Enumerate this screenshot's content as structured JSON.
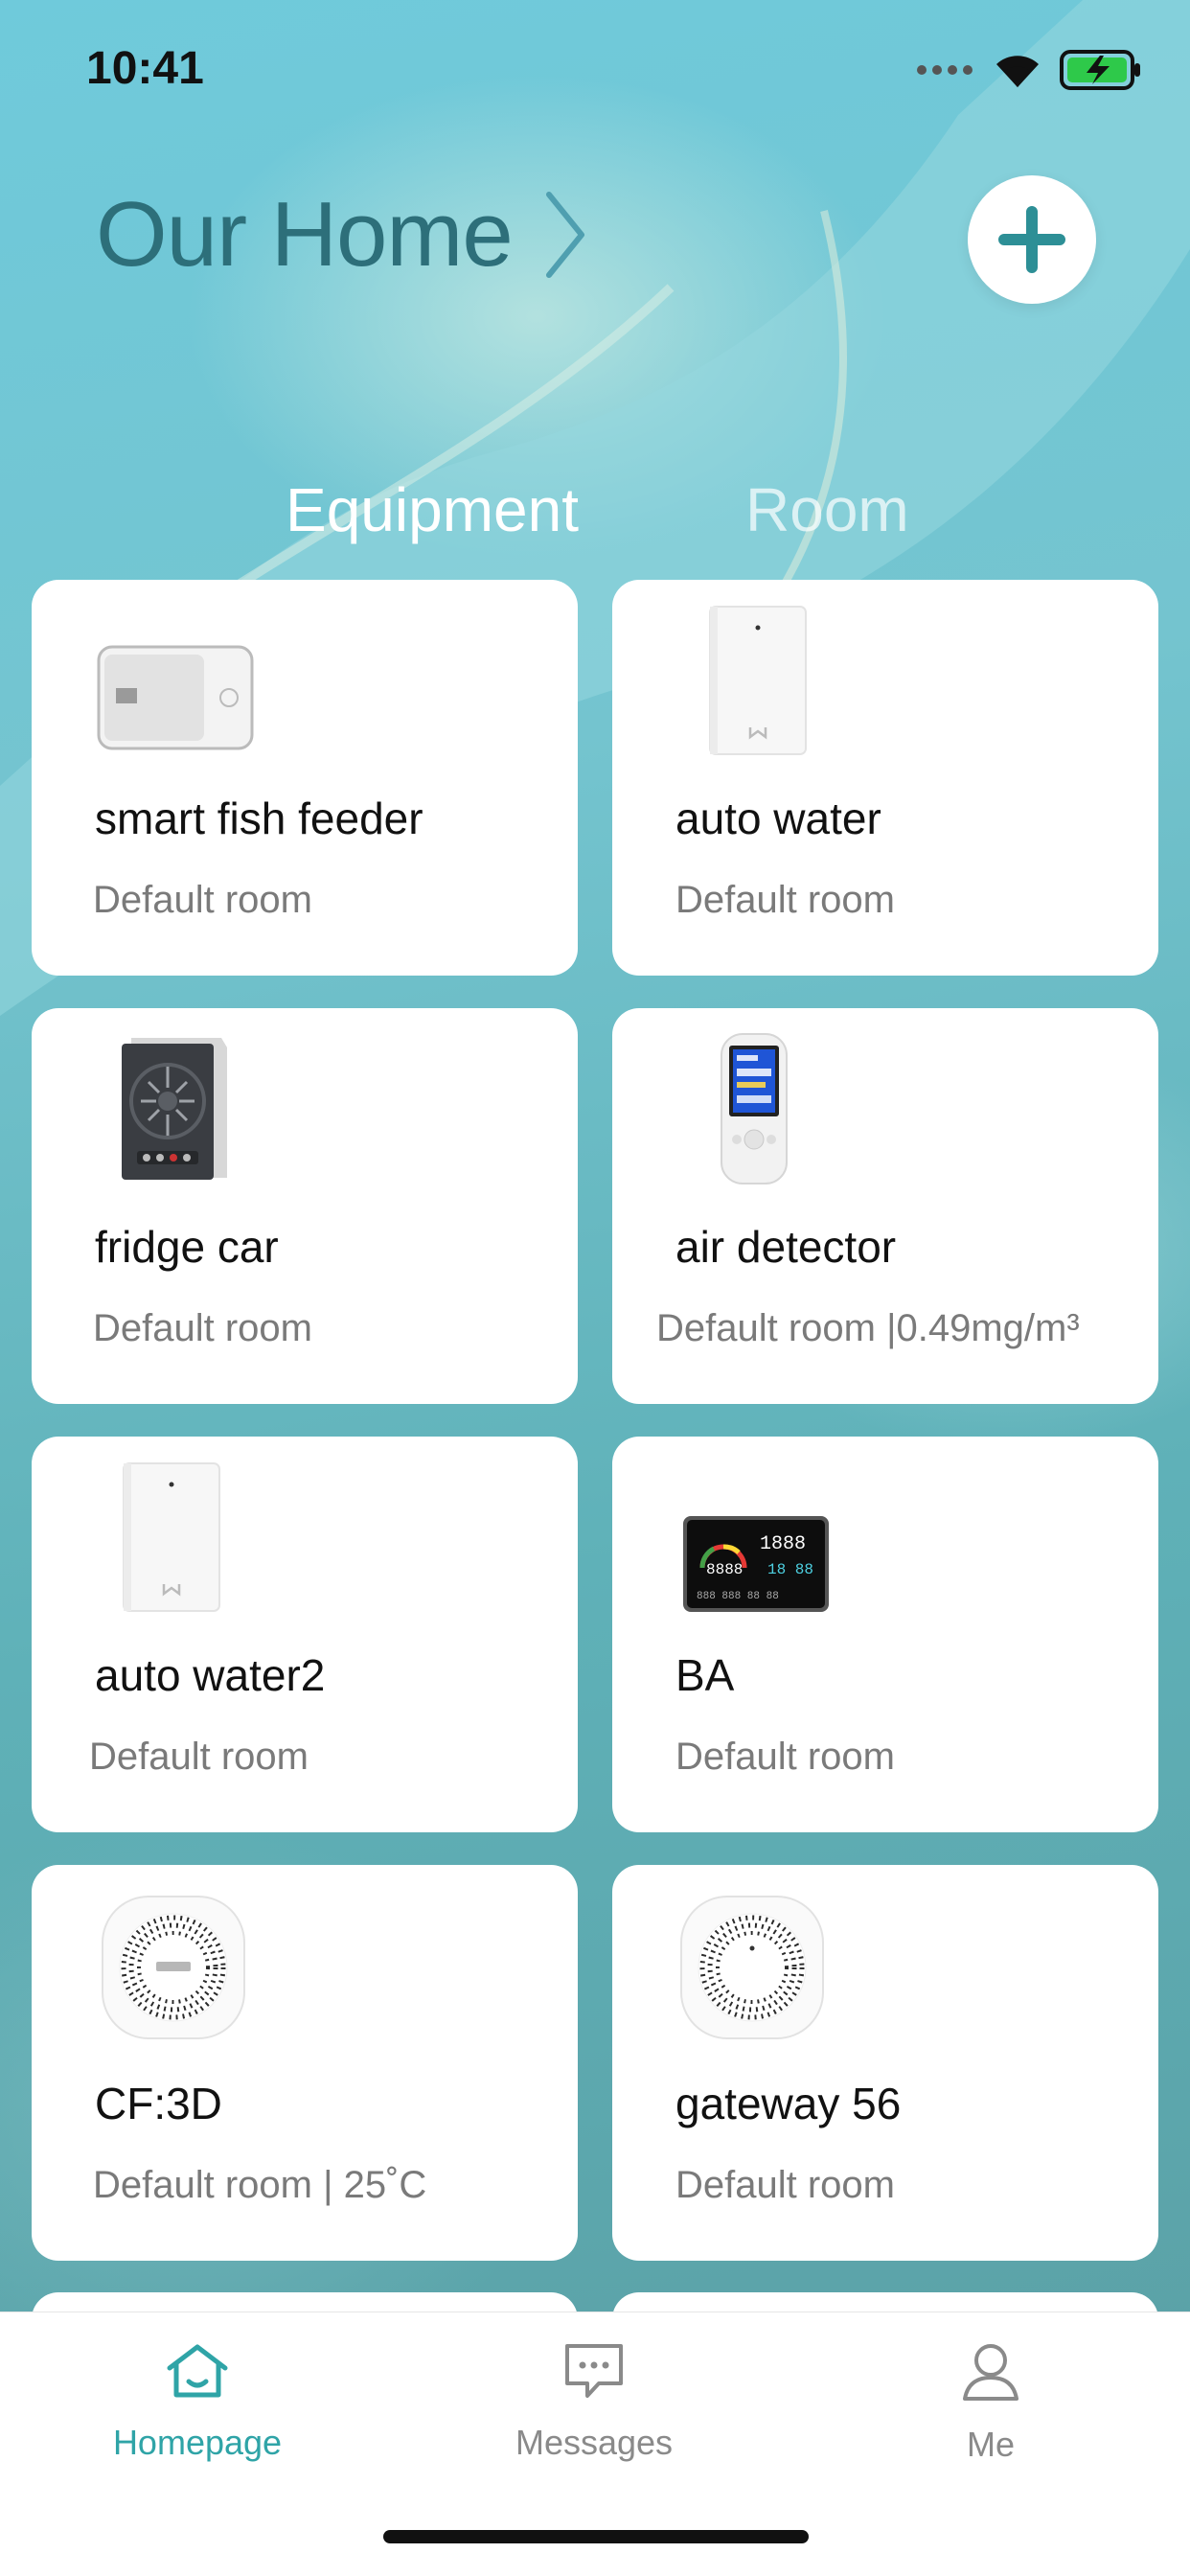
{
  "status_bar": {
    "time": "10:41",
    "icons": [
      "signal-dots-icon",
      "wifi-icon",
      "battery-charging-icon"
    ]
  },
  "header": {
    "title": "Our Home",
    "title_icon": "chevron-right-icon",
    "add_icon": "plus-icon"
  },
  "tabs": {
    "equipment": "Equipment",
    "room": "Room",
    "active": "Equipment"
  },
  "devices": [
    {
      "name": "smart fish feeder",
      "room": "Default room",
      "icon": "fish-feeder-device-icon"
    },
    {
      "name": "auto water",
      "room": "Default room",
      "icon": "water-dispenser-device-icon"
    },
    {
      "name": "fridge car",
      "room": "Default room",
      "icon": "car-fridge-device-icon"
    },
    {
      "name": "air detector",
      "room": "Default room |0.49mg/m³",
      "icon": "air-detector-device-icon"
    },
    {
      "name": "auto water2",
      "room": "Default room",
      "icon": "water-dispenser-device-icon"
    },
    {
      "name": "BA",
      "room": "Default room",
      "icon": "air-monitor-display-device-icon"
    },
    {
      "name": "CF:3D",
      "room": "Default room | 25˚C",
      "icon": "smoke-sensor-device-icon"
    },
    {
      "name": "gateway 56",
      "room": "Default room",
      "icon": "gateway-device-icon"
    }
  ],
  "tab_bar": {
    "home": {
      "label": "Homepage",
      "icon": "home-icon"
    },
    "messages": {
      "label": "Messages",
      "icon": "chat-bubble-icon"
    },
    "me": {
      "label": "Me",
      "icon": "user-icon"
    }
  },
  "colors": {
    "accent": "#2fa4a7",
    "title": "#2d6f7a",
    "inactive": "#8a8a8a"
  }
}
